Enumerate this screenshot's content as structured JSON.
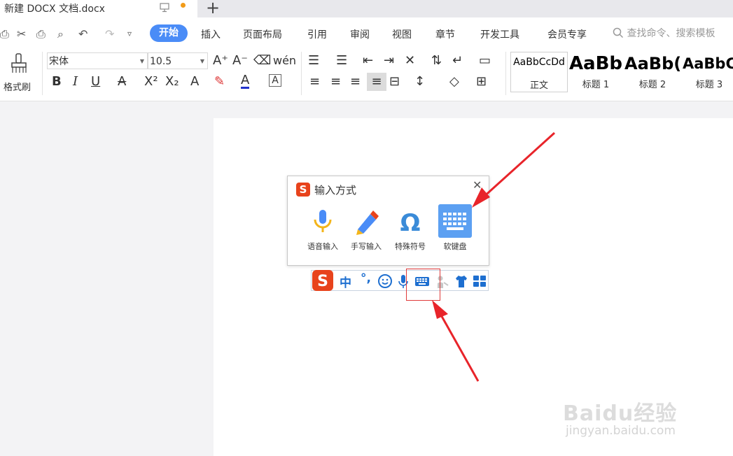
{
  "tab": {
    "title": "新建 DOCX 文档.docx",
    "new_tab": "+"
  },
  "menu": {
    "items": [
      "开始",
      "插入",
      "页面布局",
      "引用",
      "审阅",
      "视图",
      "章节",
      "开发工具",
      "会员专享"
    ],
    "search_placeholder": "查找命令、搜索模板"
  },
  "ribbon": {
    "format_painter": "格式刷",
    "font_name": "宋体",
    "font_size": "10.5",
    "styles": [
      {
        "preview": "AaBbCcDd",
        "label": "正文"
      },
      {
        "preview": "AaBb",
        "label": "标题 1"
      },
      {
        "preview": "AaBb(",
        "label": "标题 2"
      },
      {
        "preview": "AaBbC",
        "label": "标题 3"
      }
    ]
  },
  "ime_popup": {
    "title": "输入方式",
    "options": [
      {
        "label": "语音输入",
        "icon": "microphone-icon"
      },
      {
        "label": "手写输入",
        "icon": "pencil-icon"
      },
      {
        "label": "特殊符号",
        "icon": "omega-icon"
      },
      {
        "label": "软键盘",
        "icon": "keyboard-icon"
      }
    ]
  },
  "ime_bar": {
    "chinese_mode": "中",
    "punctuation": "°,",
    "logo": "S"
  },
  "watermark": {
    "brand": "Baidu经验",
    "url": "jingyan.baidu.com"
  },
  "colors": {
    "accent": "#4a8cf7",
    "sogou": "#e8431c",
    "highlight_red": "#e03b3b",
    "keyboard_blue": "#5ca0f2"
  }
}
